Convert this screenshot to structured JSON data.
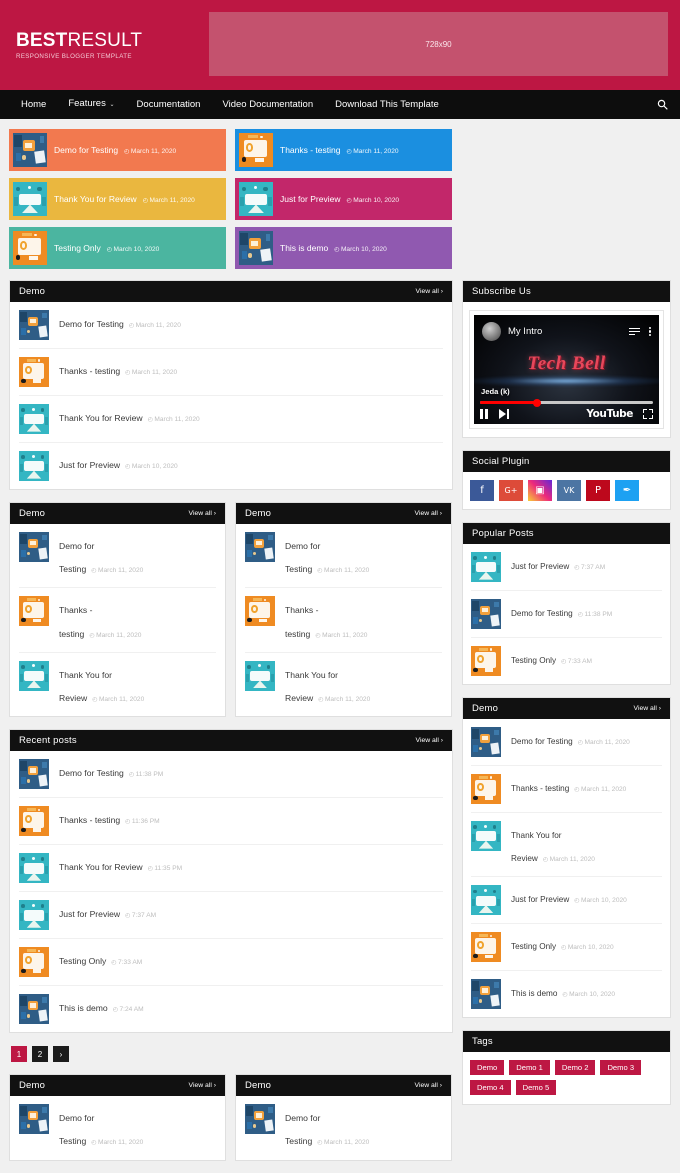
{
  "header": {
    "logo_main_bold": "BEST",
    "logo_main_light": "RESULT",
    "logo_sub": "RESPONSIVE BLOGGER TEMPLATE",
    "ad_label": "728x90",
    "brand_color": "#bd1743",
    "ad_bg_color": "#c4526e"
  },
  "nav": {
    "items": [
      {
        "label": "Home",
        "has_caret": false
      },
      {
        "label": "Features",
        "has_caret": true
      },
      {
        "label": "Documentation",
        "has_caret": false
      },
      {
        "label": "Video Documentation",
        "has_caret": false
      },
      {
        "label": "Download This Template",
        "has_caret": false
      }
    ],
    "search_icon": "search-icon"
  },
  "featured": [
    {
      "title": "Demo for Testing",
      "date": "March 11, 2020",
      "color": "#f2794f",
      "thumb": "th-blue"
    },
    {
      "title": "Thanks - testing",
      "date": "March 11, 2020",
      "color": "#1b8fe0",
      "thumb": "th-orange"
    },
    {
      "title": "Thank You for Review",
      "date": "March 11, 2020",
      "color": "#eab73f",
      "thumb": "th-teal"
    },
    {
      "title": "Just for Preview",
      "date": "March 10, 2020",
      "color": "#c2276a",
      "thumb": "th-teal"
    },
    {
      "title": "Testing Only",
      "date": "March 10, 2020",
      "color": "#4bb5a0",
      "thumb": "th-orange"
    },
    {
      "title": "This is demo",
      "date": "March 10, 2020",
      "color": "#9059b0",
      "thumb": "th-blue"
    }
  ],
  "view_all_label": "View all ›",
  "main": {
    "demo_widget": {
      "title": "Demo",
      "posts": [
        {
          "title": "Demo for Testing",
          "date": "March 11, 2020",
          "thumb": "th-blue"
        },
        {
          "title": "Thanks - testing",
          "date": "March 11, 2020",
          "thumb": "th-orange"
        },
        {
          "title": "Thank You for Review",
          "date": "March 11, 2020",
          "thumb": "th-teal"
        },
        {
          "title": "Just for Preview",
          "date": "March 10, 2020",
          "thumb": "th-teal"
        }
      ]
    },
    "demo_left": {
      "title": "Demo",
      "posts": [
        {
          "title": "Demo for Testing",
          "date": "March 11, 2020",
          "thumb": "th-blue"
        },
        {
          "title": "Thanks - testing",
          "date": "March 11, 2020",
          "thumb": "th-orange"
        },
        {
          "title": "Thank You for Review",
          "date": "March 11, 2020",
          "thumb": "th-teal"
        }
      ]
    },
    "demo_right": {
      "title": "Demo",
      "posts": [
        {
          "title": "Demo for Testing",
          "date": "March 11, 2020",
          "thumb": "th-blue"
        },
        {
          "title": "Thanks - testing",
          "date": "March 11, 2020",
          "thumb": "th-orange"
        },
        {
          "title": "Thank You for Review",
          "date": "March 11, 2020",
          "thumb": "th-teal"
        }
      ]
    },
    "recent_posts": {
      "title": "Recent posts",
      "posts": [
        {
          "title": "Demo for Testing",
          "date": "11:38 PM",
          "thumb": "th-blue"
        },
        {
          "title": "Thanks - testing",
          "date": "11:36 PM",
          "thumb": "th-orange"
        },
        {
          "title": "Thank You for Review",
          "date": "11:35 PM",
          "thumb": "th-teal"
        },
        {
          "title": "Just for Preview",
          "date": "7:37 AM",
          "thumb": "th-teal"
        },
        {
          "title": "Testing Only",
          "date": "7:33 AM",
          "thumb": "th-orange"
        },
        {
          "title": "This is demo",
          "date": "7:24 AM",
          "thumb": "th-blue"
        }
      ]
    },
    "pagination": [
      {
        "label": "1",
        "active": true
      },
      {
        "label": "2",
        "active": false
      },
      {
        "label": "›",
        "active": false
      }
    ],
    "bottom_left": {
      "title": "Demo",
      "posts": [
        {
          "title": "Demo for Testing",
          "date": "March 11, 2020",
          "thumb": "th-blue"
        }
      ]
    },
    "bottom_right": {
      "title": "Demo",
      "posts": [
        {
          "title": "Demo for Testing",
          "date": "March 11, 2020",
          "thumb": "th-blue"
        }
      ]
    }
  },
  "sidebar": {
    "subscribe": {
      "title": "Subscribe Us",
      "video": {
        "channel": "My Intro",
        "brand": "Tech Bell",
        "status_label": "Jeda (k)",
        "youtube_label": "YouTube",
        "progress_percent": 33
      }
    },
    "social": {
      "title": "Social Plugin",
      "items": [
        {
          "name": "facebook-icon",
          "glyph": "f",
          "color": "#3b5998"
        },
        {
          "name": "googleplus-icon",
          "glyph": "G+",
          "color": "#dd4b39"
        },
        {
          "name": "instagram-icon",
          "glyph": "▣",
          "color": "#c13584"
        },
        {
          "name": "vk-icon",
          "glyph": "VK",
          "color": "#4c75a3"
        },
        {
          "name": "pinterest-icon",
          "glyph": "P",
          "color": "#bd081c"
        },
        {
          "name": "twitter-icon",
          "glyph": "✒",
          "color": "#1da1f2"
        }
      ]
    },
    "popular": {
      "title": "Popular Posts",
      "posts": [
        {
          "title": "Just for Preview",
          "date": "7:37 AM",
          "thumb": "th-teal"
        },
        {
          "title": "Demo for Testing",
          "date": "11:38 PM",
          "thumb": "th-blue"
        },
        {
          "title": "Testing Only",
          "date": "7:33 AM",
          "thumb": "th-orange"
        }
      ]
    },
    "demo": {
      "title": "Demo",
      "posts": [
        {
          "title": "Demo for Testing",
          "date": "March 11, 2020",
          "thumb": "th-blue"
        },
        {
          "title": "Thanks - testing",
          "date": "March 11, 2020",
          "thumb": "th-orange"
        },
        {
          "title": "Thank You for Review",
          "date": "March 11, 2020",
          "thumb": "th-teal"
        },
        {
          "title": "Just for Preview",
          "date": "March 10, 2020",
          "thumb": "th-teal"
        },
        {
          "title": "Testing Only",
          "date": "March 10, 2020",
          "thumb": "th-orange"
        },
        {
          "title": "This is demo",
          "date": "March 10, 2020",
          "thumb": "th-blue"
        }
      ]
    },
    "tags": {
      "title": "Tags",
      "items": [
        "Demo",
        "Demo 1",
        "Demo 2",
        "Demo 3",
        "Demo 4",
        "Demo 5"
      ]
    }
  }
}
